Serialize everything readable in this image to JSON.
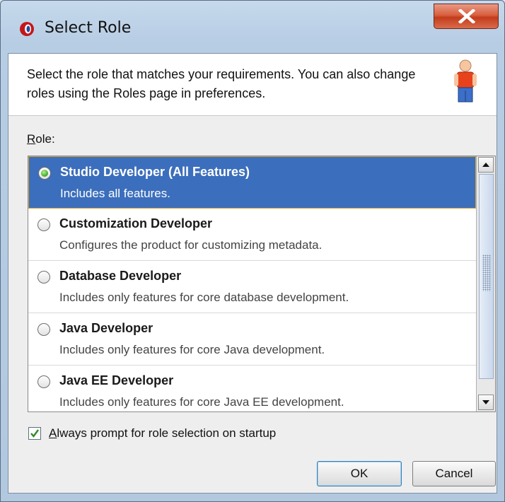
{
  "window": {
    "title": "Select Role",
    "icon": "oracle-app-icon"
  },
  "header": {
    "description": "Select the role that matches your requirements. You can also change roles using the Roles page in preferences.",
    "icon": "person-icon"
  },
  "role_label": {
    "mnemonic": "R",
    "rest": "ole:"
  },
  "roles": [
    {
      "title": "Studio Developer (All Features)",
      "description": "Includes all features.",
      "selected": true
    },
    {
      "title": "Customization Developer",
      "description": "Configures the product for customizing metadata.",
      "selected": false
    },
    {
      "title": "Database Developer",
      "description": "Includes only features for core database development.",
      "selected": false
    },
    {
      "title": "Java Developer",
      "description": "Includes only features for core Java development.",
      "selected": false
    },
    {
      "title": "Java EE Developer",
      "description": "Includes only features for core Java EE development.",
      "selected": false
    }
  ],
  "always_prompt": {
    "mnemonic": "A",
    "rest": "lways prompt for role selection on startup",
    "checked": true
  },
  "buttons": {
    "ok": "OK",
    "cancel": "Cancel"
  },
  "colors": {
    "selection": "#3b6ebc",
    "selection_border": "#d8a436",
    "check": "#2e8b21"
  }
}
